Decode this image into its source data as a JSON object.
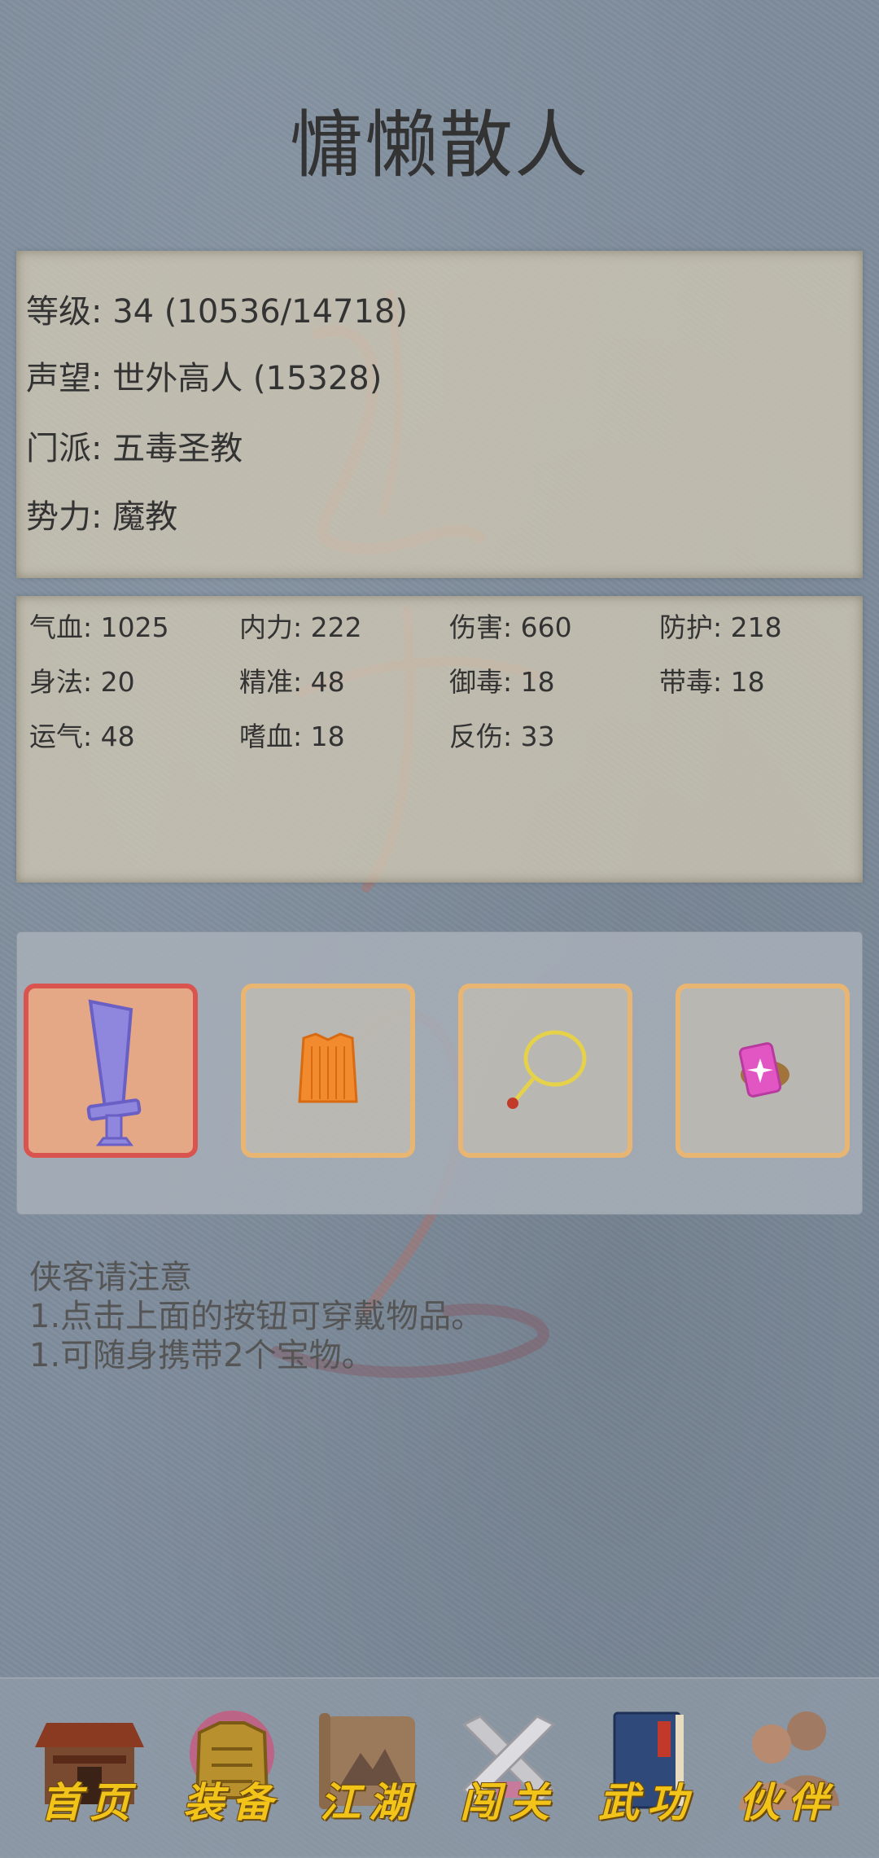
{
  "page": {
    "title": "慵懒散人"
  },
  "info": {
    "level": "等级: 34 (10536/14718)",
    "prestige": "声望: 世外高人 (15328)",
    "sect": "门派: 五毒圣教",
    "faction": "势力:  魔教"
  },
  "stats": [
    [
      "气血: 1025",
      "内力: 222",
      "伤害: 660",
      "防护: 218"
    ],
    [
      "身法: 20",
      "精准: 48",
      "御毒: 18",
      "带毒: 18"
    ],
    [
      "运气: 48",
      "嗜血: 18",
      "反伤: 33",
      ""
    ]
  ],
  "equipment": [
    {
      "icon": "sword-icon",
      "selected": true
    },
    {
      "icon": "armor-icon",
      "selected": false
    },
    {
      "icon": "necklace-icon",
      "selected": false
    },
    {
      "icon": "gem-icon",
      "selected": false
    }
  ],
  "notes": {
    "heading": "侠客请注意",
    "line1": "1.点击上面的按钮可穿戴物品。",
    "line2": "1.可随身携带2个宝物。"
  },
  "nav": [
    {
      "label": "首页",
      "icon": "house-icon"
    },
    {
      "label": "装备",
      "icon": "armor-icon"
    },
    {
      "label": "江湖",
      "icon": "scroll-icon"
    },
    {
      "label": "闯关",
      "icon": "crossed-swords-icon"
    },
    {
      "label": "武功",
      "icon": "book-icon"
    },
    {
      "label": "伙伴",
      "icon": "companions-icon"
    }
  ],
  "colors": {
    "background": "#7e8c9c",
    "paper": "#d0c8b4",
    "slot_border": "#e8b672",
    "slot_selected_border": "#d9534f",
    "nav_label": "#f2c318"
  }
}
